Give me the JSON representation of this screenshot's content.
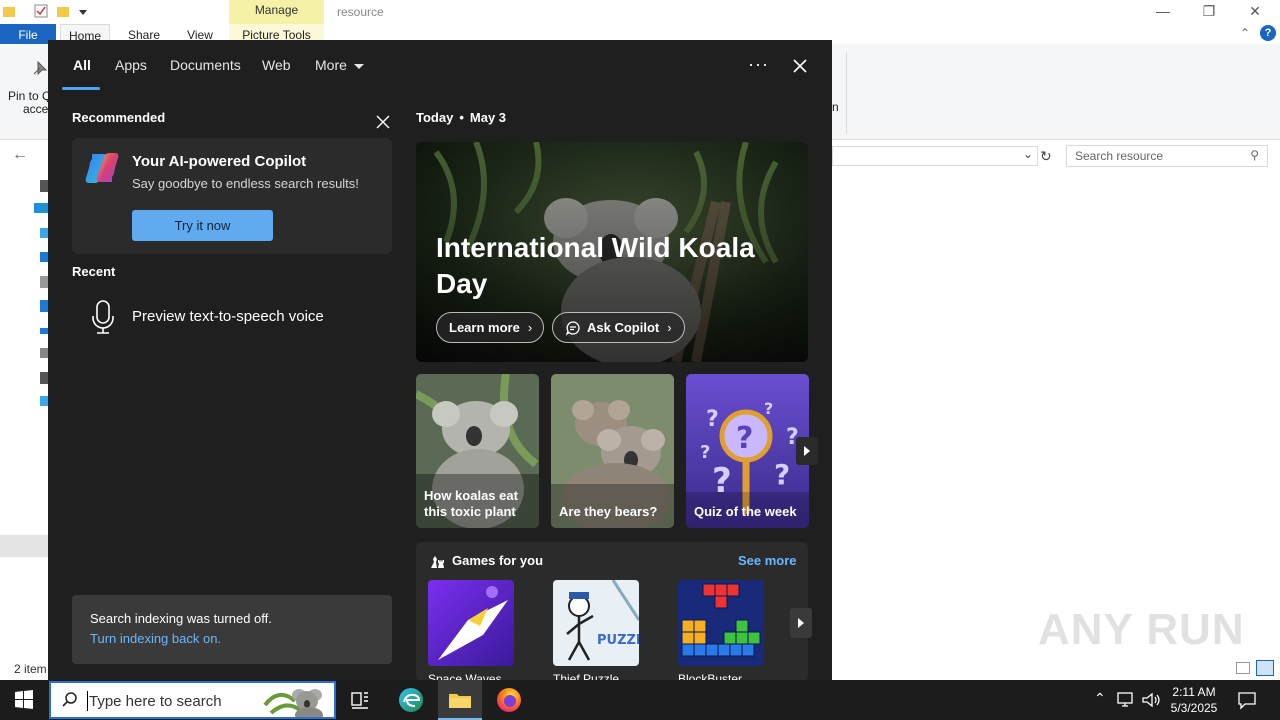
{
  "explorer": {
    "manage_tab": "Manage",
    "title": "resource",
    "tabs": [
      "File",
      "Home",
      "Share",
      "View",
      "Picture Tools"
    ],
    "ribbon_label": "Pin to Quick access",
    "ribbon_label_line1": "Pin to Q",
    "ribbon_label_line2": "acces",
    "search_placeholder": "Search resource",
    "status": "2 item",
    "watermark": "ANY RUN"
  },
  "search": {
    "tabs": [
      "All",
      "Apps",
      "Documents",
      "Web",
      "More"
    ],
    "active_tab": "All",
    "recommended_heading": "Recommended",
    "copilot": {
      "title": "Your AI-powered Copilot",
      "subtitle": "Say goodbye to endless search results!",
      "button": "Try it now"
    },
    "recent_heading": "Recent",
    "recent_items": [
      "Preview text-to-speech voice"
    ],
    "indexing": {
      "message": "Search indexing was turned off.",
      "link": "Turn indexing back on."
    },
    "today": {
      "label": "Today",
      "date": "May 3",
      "hero_title": "International Wild Koala Day",
      "learn_more": "Learn more",
      "ask_copilot": "Ask Copilot"
    },
    "tiles": [
      "How koalas eat this toxic plant",
      "Are they bears?",
      "Quiz of the week"
    ],
    "games": {
      "heading": "Games for you",
      "see_more": "See more",
      "items": [
        "Space Waves",
        "Thief Puzzle",
        "BlockBuster"
      ]
    }
  },
  "taskbar": {
    "search_placeholder": "Type here to search",
    "time": "2:11 AM",
    "date": "5/3/2025"
  },
  "colors": {
    "accent": "#4ea3f5",
    "flyout_bg": "#1f1f1f",
    "card_bg": "#2b2b2b",
    "link": "#6cb6ff",
    "button": "#60aaf0"
  }
}
